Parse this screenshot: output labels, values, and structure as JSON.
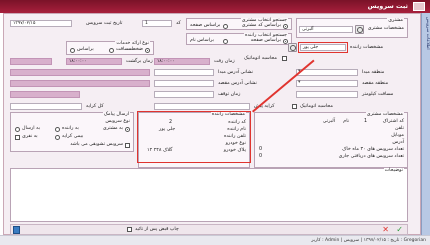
{
  "window": {
    "title": "ثبت سرویس",
    "side_tab": "اطلاعات سرویس"
  },
  "customer": {
    "title": "مشتری",
    "specs_label": "مشخصات مشتری",
    "code_label": "کد",
    "code_value": "1",
    "name_value": "آلبرتی",
    "search_by": "جستجو انتخاب مشتری",
    "by_customer_code": "براساس کد مشتری",
    "by_customer_name": "براساس صفحه",
    "date_label": "تاریخ ثبت سرویس",
    "date_value": "۱۳۹۷/۰۲/۱۵"
  },
  "driver": {
    "title": "جستجو انتخاب راننده",
    "by_code": "براساس صفحه",
    "by_name": "براساس نام",
    "specs_label": "مشخصات راننده",
    "specs_value": "جلی پور",
    "auto_calc": "محاسبه اتوماتیک"
  },
  "route": {
    "origin_label": "منطقه مبدا",
    "dest_label": "منطقه مقصد",
    "distance_label": "مسافت کیلومتر",
    "auto_calc": "محاسبه اتوماتیک"
  },
  "service_type": {
    "title": "نوع ارائه خدمات",
    "one_way": "مسافت",
    "round_trip": "براساس",
    "timed": "ضخطت"
  },
  "timing": {
    "return_time_label": "زمان برگشت",
    "return_time_value": "۱۸:۰۰:۰۰",
    "go_time_label": "زمان رفت",
    "go_time_value": "۱۸:۰۰:۰۰",
    "origin_addr_label": "نشانی آدرس مبدا",
    "dest_addr_label": "نشانی آدرس مقصد",
    "wait_label": "زمان توقف",
    "fare_label": "کرایه پیش",
    "total_fare_label": "کل کرایه",
    "extra_fare_label": "کرایه برگشت"
  },
  "customer_details": {
    "title": "مشخصات مشتری",
    "code_label": "کد اشتراک",
    "code_value": "1",
    "name_label": "نام",
    "name_value": "آلبرتی",
    "phone_label": "تلفن",
    "mobile_label": "موبایل",
    "address_label": "آدرس",
    "services_count_label": "تعداد سرویس های ۳۰ ماه خاک",
    "services_count_value": "0",
    "services_total_label": "تعداد سرویس های دریافتی جاری",
    "services_total_value": "0"
  },
  "driver_details": {
    "title": "مشخصات راننده",
    "code_label": "کد راننده",
    "code_value": "2",
    "name_label": "نام راننده",
    "name_value": "جلی پور",
    "phone_label": "تلفن راننده",
    "vehicle_label": "نوع خودرو",
    "plate_label": "پلاک خودرو",
    "plate_value": "گلاک ۲۴۸ ۱۲",
    "service_type_label": "نوع سرویس",
    "sms_label": "ارسال پیامک",
    "sms_options": [
      "به مشتری",
      "به راننده"
    ],
    "print_check": "به نفری",
    "send_all": "به ارسال",
    "payment_label": "سرویس پرداختی رایگان",
    "free_driver": "بیمی کرایه",
    "inherit_label": "سرویس تشویقی می باشد"
  },
  "notes": {
    "title": "توضیحات"
  },
  "bottom": {
    "print_invoice": "چاپ قبض پس از تائید"
  },
  "statusbar": {
    "text": "کاربر : Admin | تاریخ : ۱۳۹۷/۰۲/۱۵ | سرویس : Gregorian"
  },
  "colors": {
    "title_bg": "#a8203c",
    "accent_red": "#e0342f",
    "field_pink": "#d8b0cc",
    "panel_bg": "#fbf6fa"
  }
}
